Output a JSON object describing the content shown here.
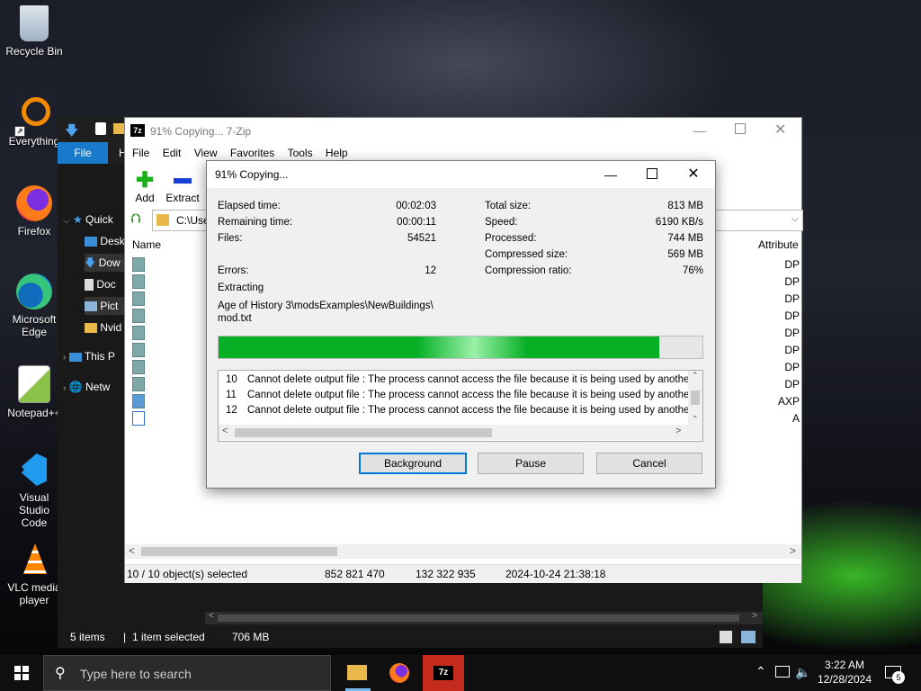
{
  "desktop": {
    "icons": [
      {
        "label": "Recycle Bin"
      },
      {
        "label": "Everything"
      },
      {
        "label": "Firefox"
      },
      {
        "label": "Microsoft Edge"
      },
      {
        "label": "Notepad++"
      },
      {
        "label": "Visual Studio Code"
      },
      {
        "label": "VLC media player"
      }
    ]
  },
  "explorer": {
    "file_tab": "File",
    "ribbon_tab2": "H",
    "nav": [
      "Quick",
      "Desk",
      "Dow",
      "Doc",
      "Pict",
      "Nvid",
      "This P",
      "Netw"
    ],
    "status": {
      "items": "5 items",
      "selected": "1 item selected",
      "size": "706 MB"
    }
  },
  "zip": {
    "title": "91% Copying... 7-Zip",
    "menu": [
      "File",
      "Edit",
      "View",
      "Favorites",
      "Tools",
      "Help"
    ],
    "toolbar": {
      "add": "Add",
      "extract": "Extract"
    },
    "address": "C:\\Use",
    "columns": {
      "name": "Name",
      "attributes": "Attribute"
    },
    "attributes": [
      "DP",
      "DP",
      "DP",
      "DP",
      "DP",
      "DP",
      "DP",
      "DP",
      "AXP",
      "A"
    ],
    "status": {
      "selected": "10 / 10 object(s) selected",
      "size": "852 821 470",
      "packed": "132 322 935",
      "modified": "2024-10-24 21:38:18"
    }
  },
  "dialog": {
    "title": "91% Copying...",
    "labels": {
      "elapsed": "Elapsed time:",
      "remaining": "Remaining time:",
      "files": "Files:",
      "errors": "Errors:",
      "total_size": "Total size:",
      "speed": "Speed:",
      "processed": "Processed:",
      "compressed_size": "Compressed size:",
      "compression_ratio": "Compression ratio:"
    },
    "values": {
      "elapsed": "00:02:03",
      "remaining": "00:00:11",
      "files": "54521",
      "errors": "12",
      "total_size": "813 MB",
      "speed": "6190 KB/s",
      "processed": "744 MB",
      "compressed_size": "569 MB",
      "compression_ratio": "76%"
    },
    "operation": "Extracting",
    "path_line1": "Age of History 3\\modsExamples\\NewBuildings\\",
    "path_line2": "mod.txt",
    "progress": 0.91,
    "log": [
      {
        "num": "10",
        "text": "Cannot delete output file : The process cannot access the file because it is being used by another proce"
      },
      {
        "num": "11",
        "text": "Cannot delete output file : The process cannot access the file because it is being used by another proce"
      },
      {
        "num": "12",
        "text": "Cannot delete output file : The process cannot access the file because it is being used by another proce"
      }
    ],
    "buttons": {
      "background": "Background",
      "pause": "Pause",
      "cancel": "Cancel"
    }
  },
  "taskbar": {
    "search_placeholder": "Type here to search",
    "time": "3:22 AM",
    "date": "12/28/2024",
    "notifications": "5"
  },
  "colors": {
    "accent": "#0078d7",
    "progress": "#06b025",
    "file_tab": "#1979ca",
    "active_app": "#c42b1c"
  }
}
